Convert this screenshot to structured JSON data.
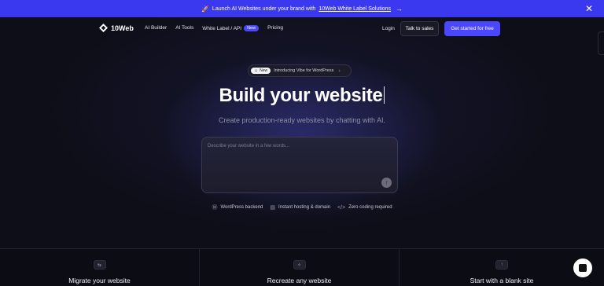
{
  "announcement": {
    "icon": "rocket-icon",
    "text": "Launch AI Websites under your brand with",
    "link": "10Web White Label Solutions",
    "arrow": "→",
    "close": "✕"
  },
  "nav": {
    "logo": "10Web",
    "links": [
      "AI Builder",
      "AI Tools",
      "White Label / API",
      "Pricing"
    ],
    "new_badge": "New",
    "login": "Login",
    "talk_to_sales": "Talk to sales",
    "get_started": "Get started for free"
  },
  "hero": {
    "pill_badge": "New",
    "pill_text": "Introducing Vibe for WordPress",
    "pill_chevron": "›",
    "headline": "Build your website",
    "subhead": "Create production-ready websites by chatting with AI.",
    "prompt_placeholder": "Describe your website in a few words..."
  },
  "features": [
    {
      "icon": "wordpress-icon",
      "glyph": "Ⓦ",
      "label": "WordPress backend"
    },
    {
      "icon": "server-icon",
      "glyph": "▤",
      "label": "Instant hosting & domain"
    },
    {
      "icon": "code-icon",
      "glyph": "</>",
      "label": "Zero coding required"
    }
  ],
  "cards": [
    {
      "icon": "migrate-icon",
      "glyph": "⇆",
      "title": "Migrate your website"
    },
    {
      "icon": "recreate-icon",
      "glyph": "✧",
      "title": "Recreate any website"
    },
    {
      "icon": "arrow-up-icon",
      "glyph": "↑",
      "title": "Start with a blank site"
    }
  ],
  "colors": {
    "brand": "#4b47ff",
    "announcement_bg": "#3b39f0",
    "background": "#0c0c14"
  }
}
